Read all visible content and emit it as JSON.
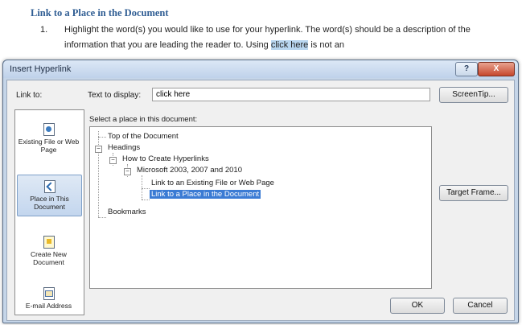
{
  "document": {
    "heading": "Link to a Place in the Document",
    "item_number": "1.",
    "paragraph_before": "Highlight the word(s) you would like to use for your hyperlink. The word(s) should be a description of the information that you are leading the reader to. Using ",
    "paragraph_highlight": "click here",
    "paragraph_after": " is not an"
  },
  "dialog": {
    "title": "Insert Hyperlink",
    "help_label": "?",
    "close_label": "X",
    "link_to_label": "Link to:",
    "text_to_display_label": "Text to display:",
    "text_to_display_value": "click here",
    "screentip_label": "ScreenTip...",
    "select_place_label": "Select a place in this document:",
    "target_frame_label": "Target Frame...",
    "ok_label": "OK",
    "cancel_label": "Cancel",
    "link_options": [
      {
        "label": "Existing File or Web Page",
        "icon": "globe-file-icon"
      },
      {
        "label": "Place in This Document",
        "icon": "document-place-icon",
        "selected": true
      },
      {
        "label": "Create New Document",
        "icon": "new-document-icon"
      },
      {
        "label": "E-mail Address",
        "icon": "email-icon"
      }
    ],
    "tree": {
      "top": "Top of the Document",
      "headings": "Headings",
      "how_to": "How to Create Hyperlinks",
      "microsoft": "Microsoft 2003, 2007 and 2010",
      "link_existing": "Link to an Existing File or Web Page",
      "link_place": "Link to a Place in the Document",
      "bookmarks": "Bookmarks",
      "expander_symbol": "−"
    }
  },
  "colors": {
    "heading": "#2f5d93",
    "selection": "#3b7bd4",
    "dialog_frame": "#c5d5e8"
  }
}
